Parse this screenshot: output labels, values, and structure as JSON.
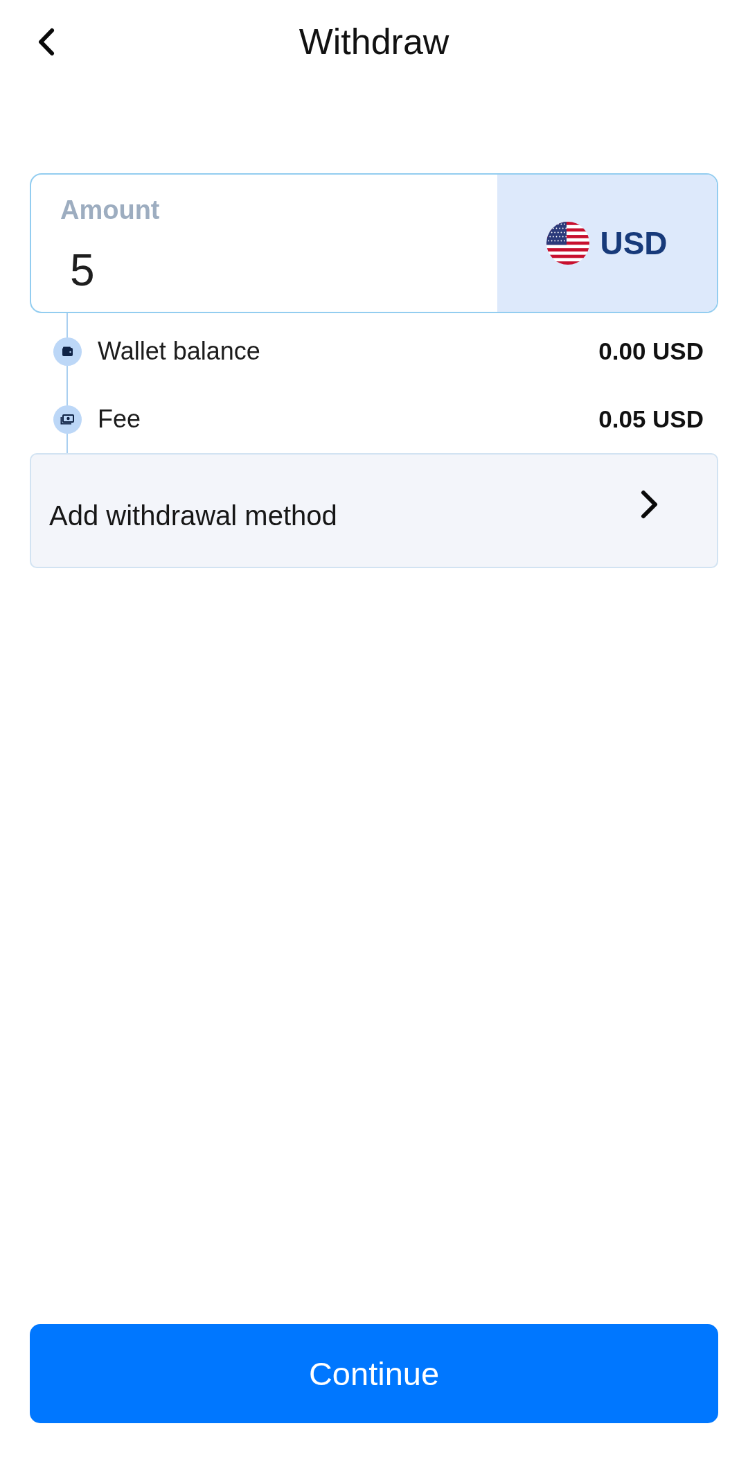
{
  "header": {
    "title": "Withdraw"
  },
  "amount": {
    "label": "Amount",
    "value": "5",
    "currency": "USD"
  },
  "summary": [
    {
      "kind": "wallet",
      "label": "Wallet balance",
      "value": "0.00 USD"
    },
    {
      "kind": "fee",
      "label": "Fee",
      "value": "0.05 USD"
    }
  ],
  "method": {
    "label": "Add withdrawal method"
  },
  "primary_button": {
    "label": "Continue"
  }
}
